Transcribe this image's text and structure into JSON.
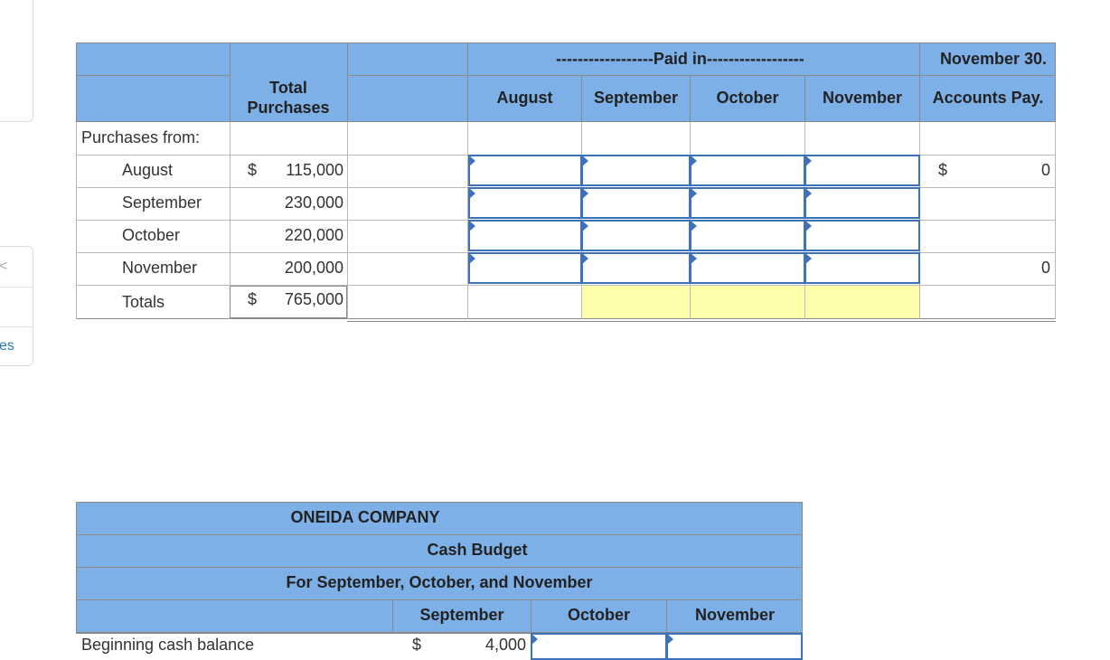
{
  "sidebar": {
    "top_card": "",
    "bottom_card_glyph_1": "<",
    "bottom_card_label": "es"
  },
  "purchases_table": {
    "paid_in_header": "------------------Paid in------------------",
    "nov30_line1": "November 30.",
    "nov30_line2": "Accounts Pay.",
    "total_purchases_line1": "Total",
    "total_purchases_line2": "Purchases",
    "month_cols": [
      "August",
      "September",
      "October",
      "November"
    ],
    "section_label": "Purchases from:",
    "rows": [
      {
        "label": "August",
        "dollar": "$",
        "total": "115,000",
        "ap_dollar": "$",
        "ap_value": "0"
      },
      {
        "label": "September",
        "dollar": "",
        "total": "230,000",
        "ap_dollar": "",
        "ap_value": ""
      },
      {
        "label": "October",
        "dollar": "",
        "total": "220,000",
        "ap_dollar": "",
        "ap_value": ""
      },
      {
        "label": "November",
        "dollar": "",
        "total": "200,000",
        "ap_dollar": "",
        "ap_value": "0"
      }
    ],
    "totals": {
      "label": "Totals",
      "dollar": "$",
      "total": "765,000"
    }
  },
  "cash_budget": {
    "company": "ONEIDA COMPANY",
    "title": "Cash Budget",
    "period": "For September, October, and November",
    "cols": [
      "September",
      "October",
      "November"
    ],
    "first_row_label": "Beginning cash balance",
    "first_row_dollar": "$",
    "first_row_value": "4,000"
  },
  "colors": {
    "header_blue": "#7eb0e8",
    "input_border": "#3d72b8",
    "highlight_yellow": "#ffffaa"
  }
}
